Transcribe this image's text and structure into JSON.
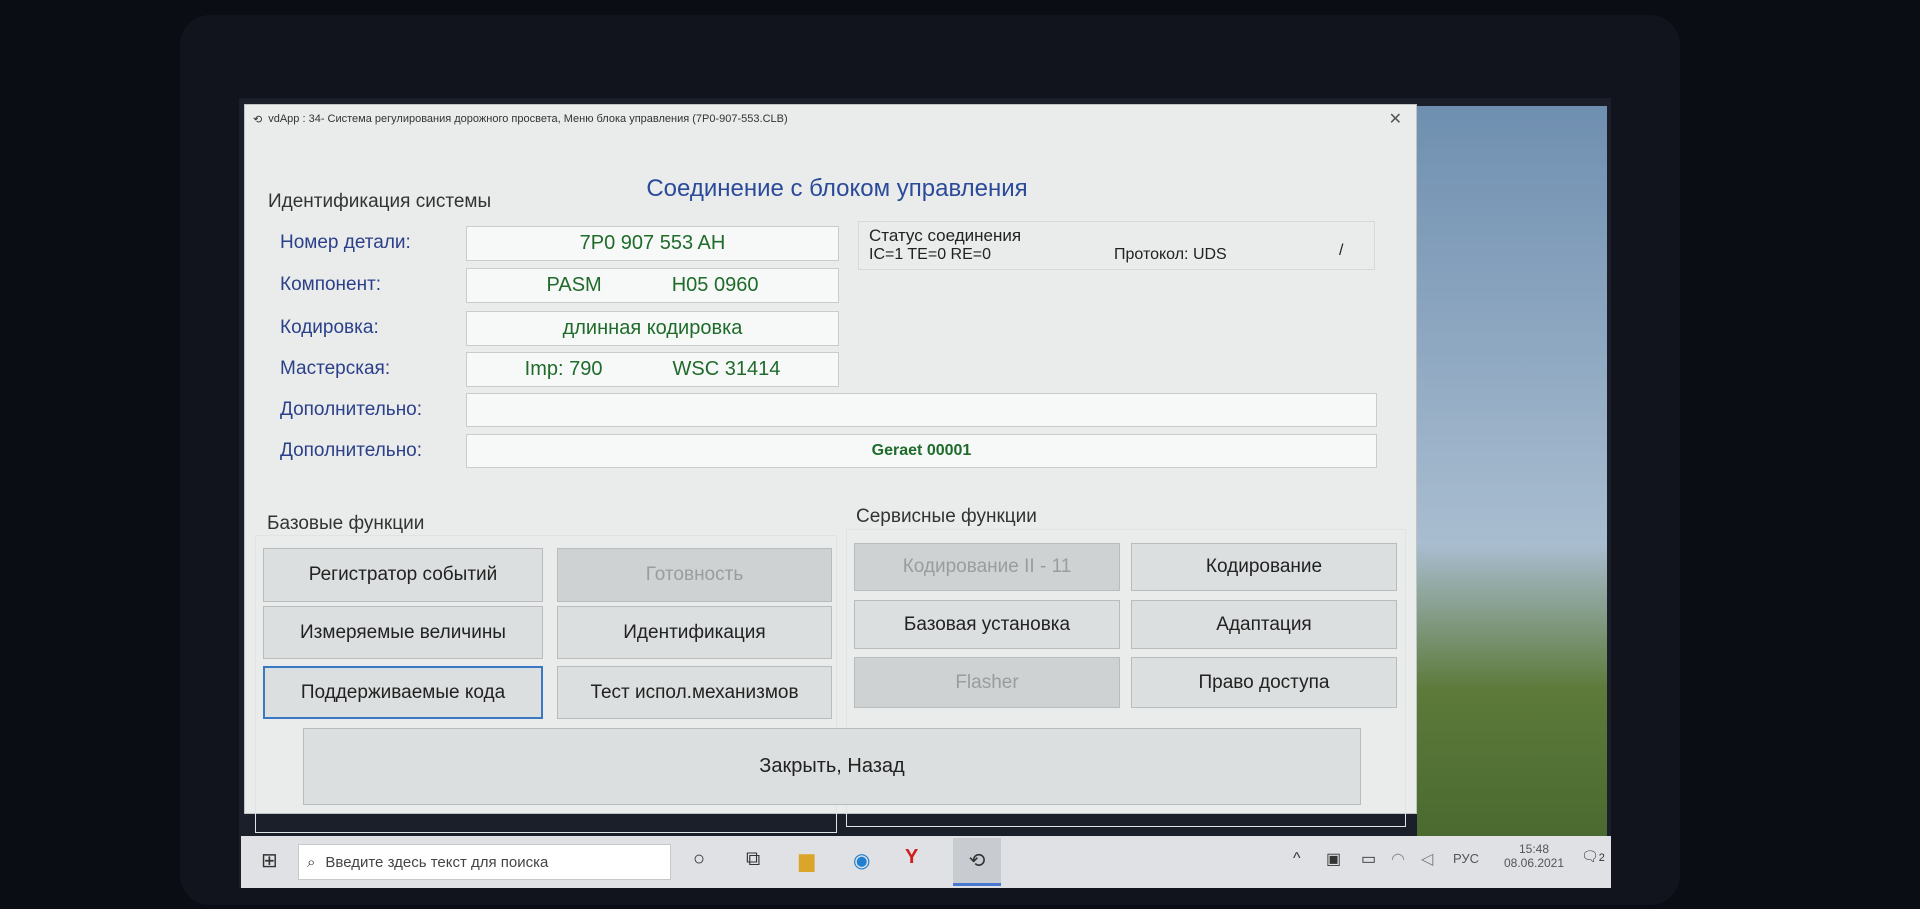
{
  "window": {
    "title": "vdApp : 34- Система регулирования дорожного просвета,  Меню блока управления (7P0-907-553.CLB)",
    "close": "✕"
  },
  "heading": "Соединение с блоком управления",
  "ident": {
    "title": "Идентификация системы",
    "rows": [
      {
        "label": "Номер детали:",
        "values": [
          "7P0 907 553 AH"
        ]
      },
      {
        "label": "Компонент:",
        "values": [
          "PASM",
          "H05 0960"
        ]
      },
      {
        "label": "Кодировка:",
        "values": [
          "длинная кодировка"
        ]
      },
      {
        "label": "Мастерская:",
        "values": [
          "Imp: 790",
          "WSC 31414"
        ]
      },
      {
        "label": "Дополнительно:",
        "values": [
          ""
        ]
      },
      {
        "label": "Дополнительно:",
        "values": [
          "Geraet 00001"
        ]
      }
    ]
  },
  "status": {
    "title": "Статус соединения",
    "values": "IC=1  TE=0  RE=0",
    "protocol": "Протокол: UDS",
    "spinner": "/"
  },
  "basic": {
    "title": "Базовые функции",
    "buttons": [
      {
        "label": "Регистратор событий",
        "enabled": true
      },
      {
        "label": "Готовность",
        "enabled": false
      },
      {
        "label": "Измеряемые величины",
        "enabled": true
      },
      {
        "label": "Идентификация",
        "enabled": true
      },
      {
        "label": "Поддерживаемые кода",
        "enabled": true,
        "focused": true
      },
      {
        "label": "Тест испол.механизмов",
        "enabled": true
      }
    ]
  },
  "service": {
    "title": "Сервисные функции",
    "buttons": [
      {
        "label": "Кодирование II - 11",
        "enabled": false
      },
      {
        "label": "Кодирование",
        "enabled": true
      },
      {
        "label": "Базовая установка",
        "enabled": true
      },
      {
        "label": "Адаптация",
        "enabled": true
      },
      {
        "label": "Flasher",
        "enabled": false
      },
      {
        "label": "Право доступа",
        "enabled": true
      }
    ]
  },
  "close_button": "Закрыть, Назад",
  "taskbar": {
    "search_placeholder": "Введите здесь текст для поиска",
    "lang": "РУС",
    "time": "15:48",
    "date": "08.06.2021",
    "notifications": "2",
    "apps": [
      "cortana-icon",
      "task-view-icon",
      "file-explorer-icon",
      "edge-icon",
      "yandex-browser-icon",
      "vdapp-icon"
    ]
  }
}
